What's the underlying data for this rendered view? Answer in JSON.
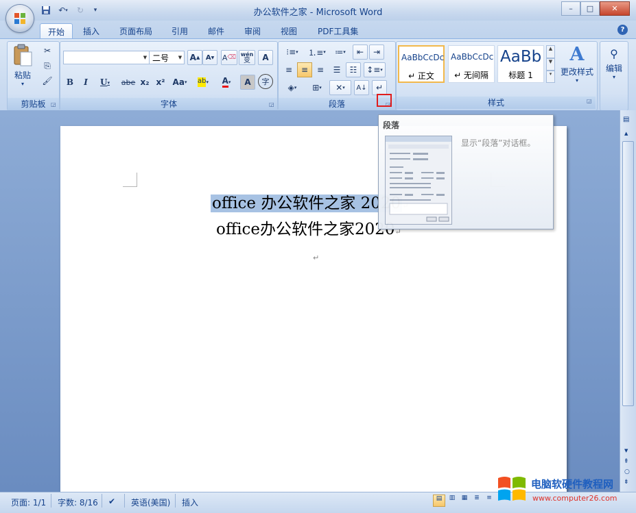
{
  "window": {
    "title": "办公软件之家 - Microsoft Word",
    "controls": {
      "minimize": "–",
      "maximize": "□",
      "close": "✕"
    },
    "help": "?"
  },
  "quick_access": {
    "save_icon": "save-icon",
    "undo_icon": "undo-icon",
    "redo_icon": "redo-icon",
    "customize_icon": "dropdown-icon"
  },
  "tabs": [
    {
      "label": "开始",
      "active": true
    },
    {
      "label": "插入"
    },
    {
      "label": "页面布局"
    },
    {
      "label": "引用"
    },
    {
      "label": "邮件"
    },
    {
      "label": "审阅"
    },
    {
      "label": "视图"
    },
    {
      "label": "PDF工具集"
    }
  ],
  "ribbon": {
    "clipboard": {
      "label": "剪贴板",
      "paste": "粘贴"
    },
    "font": {
      "label": "字体",
      "font_name": "",
      "font_size": "二号",
      "grow": "A",
      "shrink": "A",
      "clear": "A",
      "wen": "wén",
      "wen_char": "变",
      "border_char": "A",
      "bold": "B",
      "italic": "I",
      "underline": "U",
      "strike": "abe",
      "subscript": "x₂",
      "superscript": "x²",
      "case": "Aa",
      "highlight": "ab",
      "font_color": "A",
      "shading": "A",
      "enclose": "字"
    },
    "paragraph": {
      "label": "段落"
    },
    "styles": {
      "label": "样式",
      "items": [
        {
          "sample": "AaBbCcDc",
          "name": "↵ 正文",
          "selected": true
        },
        {
          "sample": "AaBbCcDc",
          "name": "↵ 无间隔"
        },
        {
          "sample": "AaBb",
          "name": "标题 1"
        }
      ],
      "change": "更改样式"
    },
    "editing": {
      "label": "编辑"
    }
  },
  "tooltip": {
    "title": "段落",
    "description": "显示“段落”对话框。"
  },
  "document": {
    "line1": "office 办公软件之家 2020",
    "line2": "office办公软件之家2020",
    "para_mark": "↵"
  },
  "status_bar": {
    "page": "页面: 1/1",
    "words": "字数: 8/16",
    "language": "英语(美国)",
    "mode": "插入"
  },
  "watermark": {
    "text": "电脑软硬件教程网",
    "url": "www.computer26.com"
  },
  "colors": {
    "accent": "#15428b",
    "selection": "#a7c2e3",
    "highlight_box": "#e01c1c"
  }
}
